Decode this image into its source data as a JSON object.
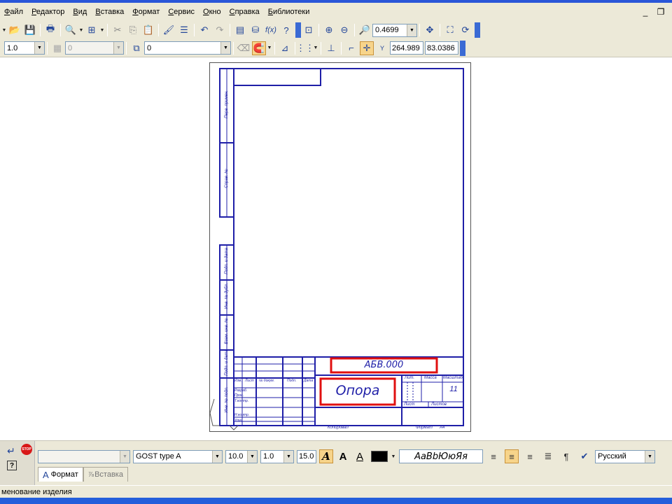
{
  "menu": {
    "items": [
      "Файл",
      "Редактор",
      "Вид",
      "Вставка",
      "Формат",
      "Сервис",
      "Окно",
      "Справка",
      "Библиотеки"
    ]
  },
  "toolbar_main": {
    "zoom_value": "0.4699"
  },
  "toolbar_props": {
    "line_scale": "1.0",
    "layer_value": "0",
    "style_value": "0",
    "x_coord": "264.989",
    "y_coord": "83.0386",
    "y_prefix": "Y"
  },
  "drawing": {
    "designation": "АБВ.000",
    "part_name": "Опора",
    "sheets_count": "11",
    "col_lit": "Лит.",
    "col_mass": "Масса",
    "col_scale": "Масштаб",
    "col_sheet": "Лист",
    "col_sheets": "Листов",
    "row_izm": "Изм.",
    "row_list": "Лист",
    "row_doc": "№ докум.",
    "row_sign": "Подп.",
    "row_date": "Дата",
    "row_razrab": "Разраб.",
    "row_prov": "Пров.",
    "row_tkontr": "Т.контр.",
    "row_nkontr": "Н.контр.",
    "row_utv": "Утв.",
    "side_perv": "Перв. примен.",
    "side_sprav": "Справ. №",
    "side_podp_data1": "Подп. и дата",
    "side_inv_dubl": "Инв. № дубл.",
    "side_vzam": "Взам. инв. №",
    "side_podp_data2": "Подп. и дата",
    "side_inv_podl": "Инв. № подл.",
    "copied": "Копировал",
    "format_label": "Формат",
    "format_value": "A4"
  },
  "text_panel": {
    "font_name": "GOST type A",
    "font_size": "10.0",
    "line_spacing": "1.0",
    "width_value": "15.0",
    "sample_text": "АаВbЮюЯя",
    "language": "Русский",
    "text_color": "#000000",
    "tabs": [
      "Формат",
      "Вставка"
    ]
  },
  "status": {
    "text": "менование изделия"
  },
  "colors": {
    "frame_blue": "#1f1fa8",
    "highlight_red": "#e01010",
    "ui_bg": "#ece9d8",
    "title_blue": "#2a56d8"
  }
}
